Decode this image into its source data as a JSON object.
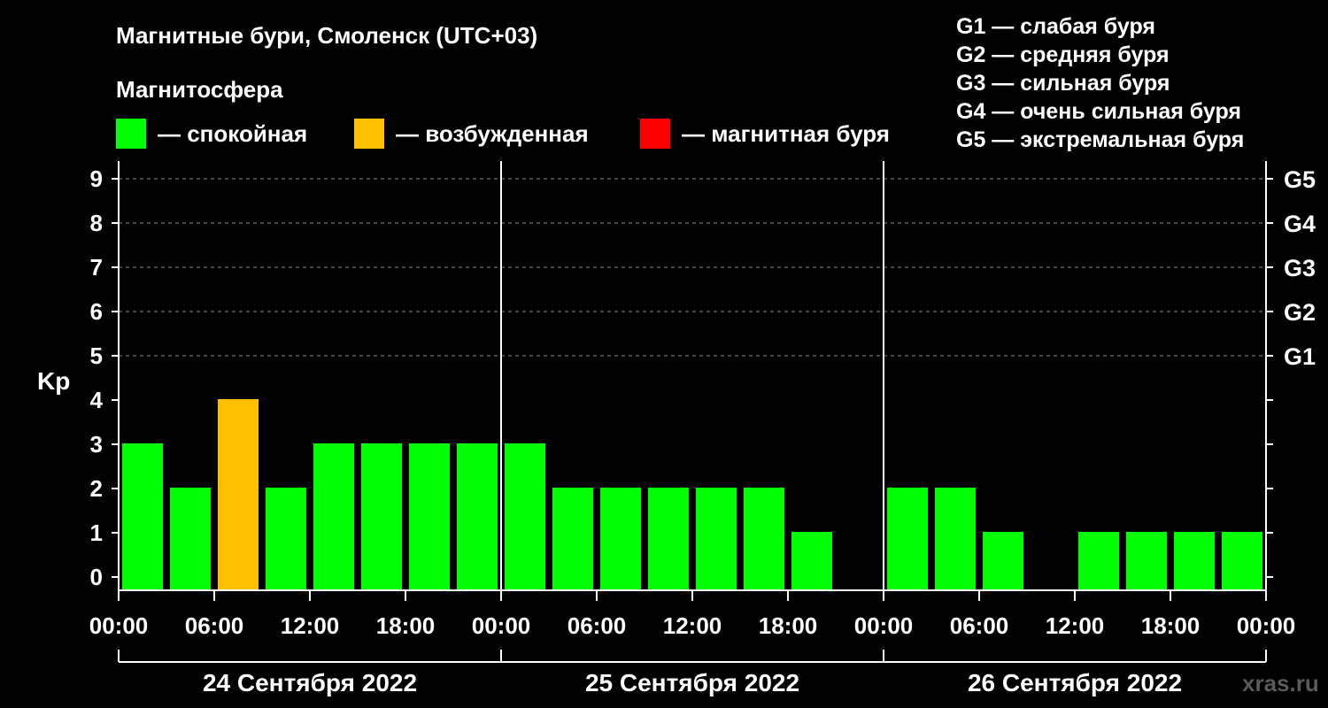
{
  "title": "Магнитные бури, Смоленск (UTC+03)",
  "subtitle": "Магнитосфера",
  "legend": [
    {
      "color": "#00ff00",
      "label": "— спокойная"
    },
    {
      "color": "#ffc000",
      "label": "— возбужденная"
    },
    {
      "color": "#ff0000",
      "label": "— магнитная буря"
    }
  ],
  "g_legend": [
    "G1 — слабая буря",
    "G2 — средняя буря",
    "G3 — сильная буря",
    "G4 — очень сильная буря",
    "G5 — экстремальная буря"
  ],
  "watermark": "xras.ru",
  "chart_data": {
    "type": "bar",
    "ylabel": "Kp",
    "ylim": [
      0,
      9
    ],
    "yticks": [
      0,
      1,
      2,
      3,
      4,
      5,
      6,
      7,
      8,
      9
    ],
    "g_levels": [
      {
        "kp": 5,
        "label": "G1"
      },
      {
        "kp": 6,
        "label": "G2"
      },
      {
        "kp": 7,
        "label": "G3"
      },
      {
        "kp": 8,
        "label": "G4"
      },
      {
        "kp": 9,
        "label": "G5"
      }
    ],
    "x_tick_labels": [
      "00:00",
      "06:00",
      "12:00",
      "18:00",
      "00:00",
      "06:00",
      "12:00",
      "18:00",
      "00:00",
      "06:00",
      "12:00",
      "18:00",
      "00:00"
    ],
    "days": [
      "24 Сентября 2022",
      "25 Сентября 2022",
      "26 Сентября 2022"
    ],
    "intervals_per_day": 8,
    "interval_hours": 3,
    "grid": "dashed horizontal at Kp 5-9",
    "colors": {
      "calm": "#00ff00",
      "active": "#ffc000",
      "storm": "#ff0000"
    },
    "values": [
      3,
      2,
      4,
      2,
      3,
      3,
      3,
      3,
      3,
      2,
      2,
      2,
      2,
      2,
      1,
      0,
      2,
      2,
      1,
      0,
      1,
      1,
      1,
      1
    ]
  }
}
